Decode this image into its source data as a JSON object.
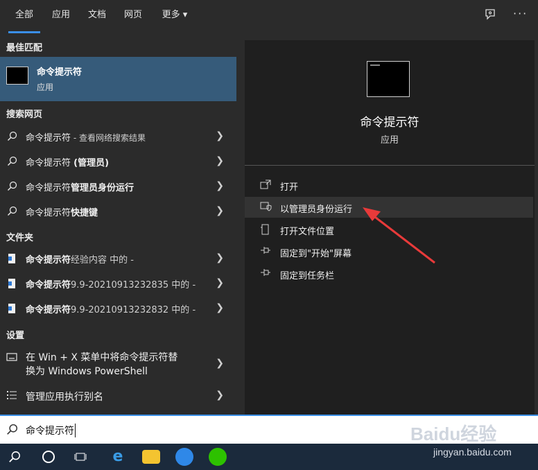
{
  "tabs": [
    "全部",
    "应用",
    "文档",
    "网页",
    "更多 ▾"
  ],
  "best_match": {
    "section": "最佳匹配",
    "title": "命令提示符",
    "subtitle": "应用"
  },
  "web": {
    "section": "搜索网页",
    "items": [
      {
        "main": "命令提示符",
        "extra": " - 查看网络搜索结果"
      },
      {
        "main": "命令提示符 ",
        "extra": "(管理员)"
      },
      {
        "main": "命令提示符",
        "extra": "管理员身份运行"
      },
      {
        "main": "命令提示符",
        "extra": "快捷键"
      }
    ]
  },
  "folders": {
    "section": "文件夹",
    "items": [
      {
        "main": "命令提示符",
        "extra": "经验内容 中的 -"
      },
      {
        "main": "命令提示符",
        "extra": "9.9-20210913232835 中的 -"
      },
      {
        "main": "命令提示符",
        "extra": "9.9-20210913232832 中的 -"
      }
    ]
  },
  "settings": {
    "section": "设置",
    "item1_line1": "在 Win + X 菜单中将命令提示符替",
    "item1_line2": "换为 Windows PowerShell",
    "item2": "管理应用执行别名"
  },
  "detail": {
    "title": "命令提示符",
    "subtitle": "应用",
    "actions": [
      "打开",
      "以管理员身份运行",
      "打开文件位置",
      "固定到\"开始\"屏幕",
      "固定到任务栏"
    ]
  },
  "search": {
    "value": "命令提示符"
  },
  "watermark": {
    "brand": "Baidu经验",
    "url": "jingyan.baidu.com"
  },
  "icons": {
    "search": "search-icon",
    "feedback": "feedback-icon",
    "more": "more-icon",
    "chevron": "chevron-right-icon"
  },
  "colors": {
    "accent": "#3a8ee6",
    "selected": "#365b7a",
    "arrow": "#e83a3a"
  }
}
